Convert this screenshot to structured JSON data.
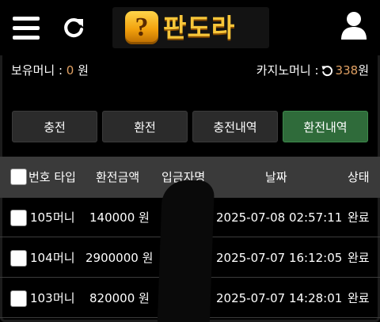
{
  "header": {
    "logo_text": "판도라",
    "logo_badge": "?"
  },
  "balance": {
    "holding_label": "보유머니 : ",
    "holding_value": "0",
    "holding_unit": " 원",
    "casino_label": "카지노머니 : ",
    "casino_value": "338",
    "casino_unit": " 원"
  },
  "tabs": [
    {
      "label": "충전",
      "active": false
    },
    {
      "label": "환전",
      "active": false
    },
    {
      "label": "충전내역",
      "active": false
    },
    {
      "label": "환전내역",
      "active": true
    }
  ],
  "table": {
    "headers": {
      "number_type": "번호 타입",
      "amount": "환전금액",
      "depositor": "입금자명",
      "date": "날짜",
      "status": "상태"
    },
    "rows": [
      {
        "number": "105",
        "type": "머니",
        "amount": "140000 원",
        "date": "2025-07-08 02:57:11",
        "status": "완료"
      },
      {
        "number": "104",
        "type": "머니",
        "amount": "2900000 원",
        "date": "2025-07-07 16:12:05",
        "status": "완료"
      },
      {
        "number": "103",
        "type": "머니",
        "amount": "820000 원",
        "date": "2025-07-07 14:28:01",
        "status": "완료"
      }
    ]
  },
  "colors": {
    "accent_value": "#e0a063",
    "active_tab": "#2f6b3a",
    "tab": "#2b2b2b",
    "header_row": "#3a3a3a"
  },
  "icons": {
    "menu": "hamburger-menu-icon",
    "refresh": "refresh-icon",
    "user": "user-icon",
    "casino_refresh": "small-refresh-icon"
  }
}
